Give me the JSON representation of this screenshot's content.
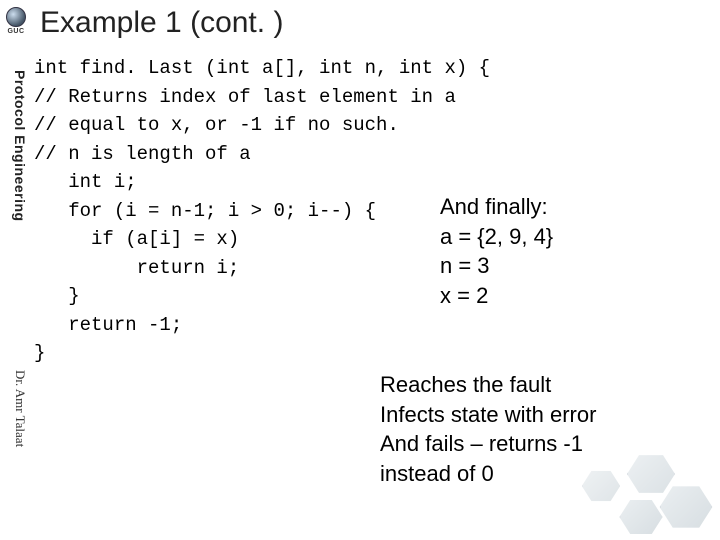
{
  "brand": {
    "short": "GUC"
  },
  "sidebar": {
    "course": "Protocol Engineering",
    "author": "Dr. Amr Talaat"
  },
  "title": "Example 1 (cont. )",
  "code": "int find. Last (int a[], int n, int x) {\n// Returns index of last element in a\n// equal to x, or -1 if no such.\n// n is length of a\n   int i;\n   for (i = n-1; i > 0; i--) {\n     if (a[i] = x)\n         return i;\n   }\n   return -1;\n}",
  "annotation": {
    "setup": "And finally:\na = {2, 9, 4}\nn = 3\nx = 2",
    "result": "Reaches the fault\nInfects state with error\nAnd fails – returns -1\ninstead of 0"
  }
}
